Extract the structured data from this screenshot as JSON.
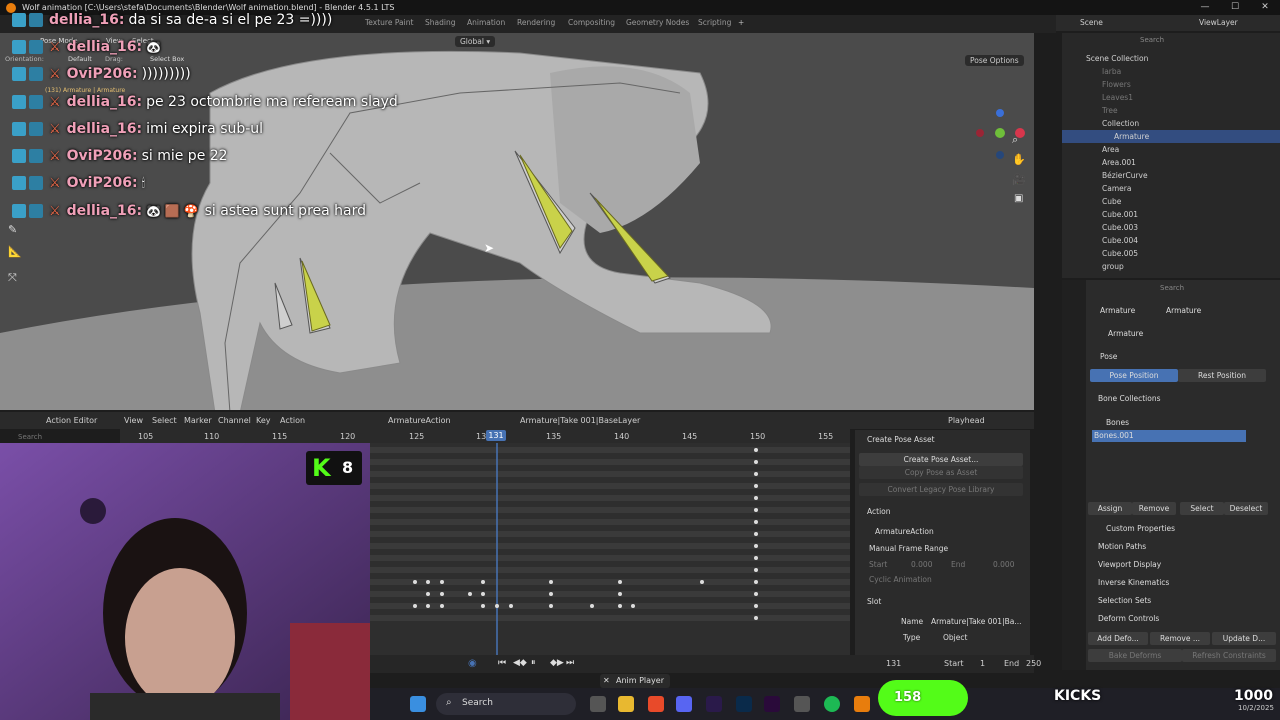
{
  "window": {
    "title": "Wolf animation [C:\\Users\\stefa\\Documents\\Blender\\Wolf animation.blend] - Blender 4.5.1 LTS"
  },
  "workspace_tabs": [
    "Texture Paint",
    "Shading",
    "Animation",
    "Rendering",
    "Compositing",
    "Geometry Nodes",
    "Scripting"
  ],
  "viewport": {
    "mode": "Pose Mode",
    "orientation": "Global",
    "view_menu": "View",
    "select_menu": "Select",
    "pose_menu": "Pose",
    "orientation_label": "Orientation:",
    "orientation_value": "Default",
    "drag_label": "Drag:",
    "drag_value": "Select Box",
    "info_line": "(131) Armature | Armature",
    "pose_options": "Pose Options"
  },
  "chat": [
    {
      "user": "dellia_16:",
      "text": "da si sa de-a si el pe 23 =))))"
    },
    {
      "user": "dellia_16:",
      "text": ""
    },
    {
      "user": "OviP206:",
      "text": ")))))))))"
    },
    {
      "user": "dellia_16:",
      "text": "pe 23 octombrie ma refeream slayd"
    },
    {
      "user": "dellia_16:",
      "text": "imi expira sub-ul"
    },
    {
      "user": "OviP206:",
      "text": "si mie pe 22"
    },
    {
      "user": "OviP206:",
      "text": ""
    },
    {
      "user": "dellia_16:",
      "text": "si astea sunt prea hard"
    }
  ],
  "outliner": {
    "scene": "Scene",
    "view_layer": "ViewLayer",
    "search_placeholder": "Search",
    "root": "Scene Collection",
    "items": [
      "Iarba",
      "Flowers",
      "Leaves1",
      "Tree",
      "Collection",
      "Armature",
      "Area",
      "Area.001",
      "BézierCurve",
      "Camera",
      "Cube",
      "Cube.001",
      "Cube.003",
      "Cube.004",
      "Cube.005",
      "group"
    ]
  },
  "properties": {
    "search_placeholder": "Search",
    "breadcrumb_1": "Armature",
    "breadcrumb_2": "Armature",
    "name_field": "Armature",
    "pose_panel": "Pose",
    "pose_position": "Pose Position",
    "rest_position": "Rest Position",
    "bone_collections": "Bone Collections",
    "collection_items": [
      "Bones",
      "Bones.001"
    ],
    "assign": "Assign",
    "remove": "Remove",
    "select": "Select",
    "deselect": "Deselect",
    "panels": [
      "Custom Properties",
      "Motion Paths",
      "Viewport Display",
      "Inverse Kinematics",
      "Selection Sets",
      "Deform Controls"
    ],
    "add_deform": "Add Defo...",
    "remove_deform": "Remove ...",
    "update_deform": "Update D...",
    "bake_deforms": "Bake Deforms",
    "refresh_constraints": "Refresh Constraints"
  },
  "action_editor": {
    "editor_type": "Action Editor",
    "menus": [
      "View",
      "Select",
      "Marker",
      "Channel",
      "Key",
      "Action"
    ],
    "action_name": "ArmatureAction",
    "slot_name": "Armature|Take 001|BaseLayer",
    "playhead": "Playhead",
    "search_placeholder": "Search",
    "ruler": [
      "105",
      "110",
      "115",
      "120",
      "125",
      "130",
      "131",
      "135",
      "140",
      "145",
      "150",
      "155"
    ],
    "current_frame": "131"
  },
  "side_panel": {
    "create_pose_asset_header": "Create Pose Asset",
    "create_pose_asset": "Create Pose Asset...",
    "copy_pose": "Copy Pose as Asset",
    "convert_library": "Convert Legacy Pose Library",
    "action_header": "Action",
    "action_name": "ArmatureAction",
    "manual_frame_range": "Manual Frame Range",
    "start_label": "Start",
    "start_value": "0.000",
    "end_label": "End",
    "end_value": "0.000",
    "cyclic": "Cyclic Animation",
    "slot_header": "Slot",
    "name_label": "Name",
    "name_value": "Armature|Take 001|Ba...",
    "type_label": "Type",
    "type_value": "Object"
  },
  "timeline_footer": {
    "frame": "131",
    "start_label": "Start",
    "start_value": "1",
    "end_label": "End",
    "end_value": "250"
  },
  "taskbar": {
    "search": "Search",
    "anim_player": "Anim Player",
    "kick_count": "158",
    "kicks_label": "KICKS",
    "kicks_value": "1000",
    "date": "10/2/2025"
  },
  "overlay": {
    "k_badge_value": "8"
  },
  "colors": {
    "accent_blue": "#4772b3",
    "kick_green": "#53fc18",
    "bone_yellow": "#c9d24a"
  }
}
